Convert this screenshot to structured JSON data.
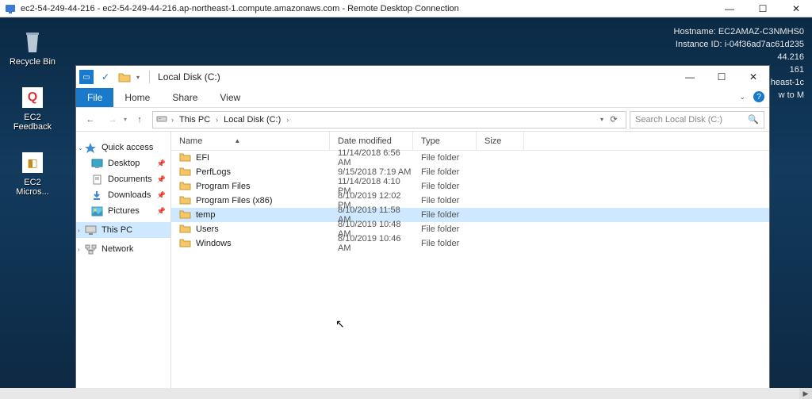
{
  "rdp": {
    "title": "ec2-54-249-44-216 - ec2-54-249-44-216.ap-northeast-1.compute.amazonaws.com - Remote Desktop Connection",
    "minimize": "—",
    "maximize": "☐",
    "close": "✕"
  },
  "bginfo": {
    "hostname_label": "Hostname:",
    "hostname": "EC2AMAZ-C3NMHS0",
    "instance_label": "Instance ID:",
    "instance": "i-04f36ad7ac61d235",
    "line3": "44.216",
    "line4": "161",
    "line5": "heast-1c",
    "line6": "w to M"
  },
  "desktop_icons": {
    "recycle": "Recycle Bin",
    "feedback": "EC2 Feedback",
    "micros": "EC2 Micros..."
  },
  "explorer": {
    "title": "Local Disk (C:)",
    "tabs": {
      "file": "File",
      "home": "Home",
      "share": "Share",
      "view": "View"
    },
    "breadcrumb": {
      "thispc": "This PC",
      "drive": "Local Disk (C:)"
    },
    "search_placeholder": "Search Local Disk (C:)",
    "nav": {
      "quick": "Quick access",
      "desktop": "Desktop",
      "documents": "Documents",
      "downloads": "Downloads",
      "pictures": "Pictures",
      "thispc": "This PC",
      "network": "Network"
    },
    "columns": {
      "name": "Name",
      "date": "Date modified",
      "type": "Type",
      "size": "Size"
    },
    "rows": [
      {
        "name": "EFI",
        "date": "11/14/2018 6:56 AM",
        "type": "File folder",
        "selected": false
      },
      {
        "name": "PerfLogs",
        "date": "9/15/2018 7:19 AM",
        "type": "File folder",
        "selected": false
      },
      {
        "name": "Program Files",
        "date": "11/14/2018 4:10 PM",
        "type": "File folder",
        "selected": false
      },
      {
        "name": "Program Files (x86)",
        "date": "8/10/2019 12:02 PM",
        "type": "File folder",
        "selected": false
      },
      {
        "name": "temp",
        "date": "8/10/2019 11:58 AM",
        "type": "File folder",
        "selected": true
      },
      {
        "name": "Users",
        "date": "8/10/2019 10:48 AM",
        "type": "File folder",
        "selected": false
      },
      {
        "name": "Windows",
        "date": "8/10/2019 10:46 AM",
        "type": "File folder",
        "selected": false
      }
    ],
    "win": {
      "minimize": "—",
      "maximize": "☐",
      "close": "✕"
    }
  }
}
